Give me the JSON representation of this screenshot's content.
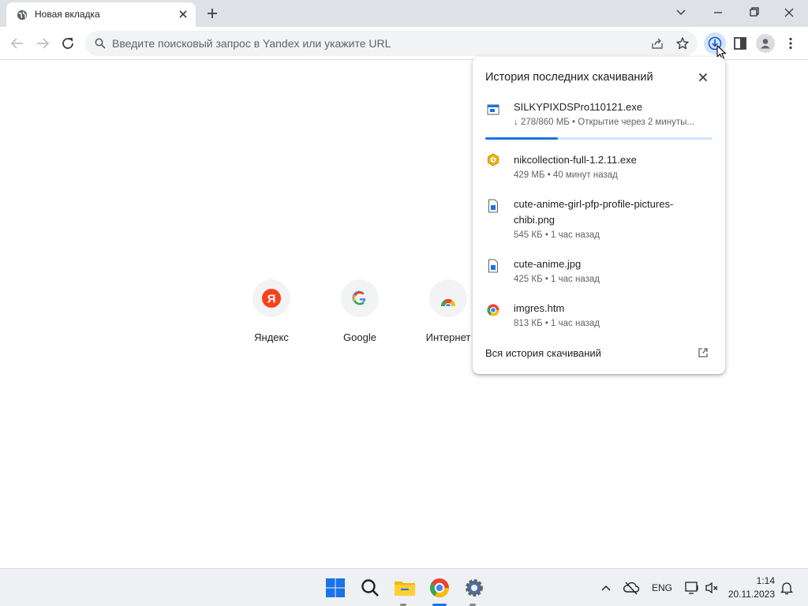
{
  "browser": {
    "tab_title": "Новая вкладка",
    "omnibox_placeholder": "Введите поисковый запрос в Yandex или укажите URL"
  },
  "shortcuts": [
    {
      "label": "Яндекс",
      "icon": "yandex-icon"
    },
    {
      "label": "Google",
      "icon": "google-icon"
    },
    {
      "label": "Интернет",
      "icon": "chrome-webstore-icon"
    }
  ],
  "downloads": {
    "title": "История последних скачиваний",
    "items": [
      {
        "name": "SILKYPIXDSPro110121.exe",
        "status": "↓ 278/860 МБ • Открытие через 2 минуты...",
        "icon": "exe-installer-icon",
        "progress": 0.32
      },
      {
        "name": "nikcollection-full-1.2.11.exe",
        "status": "429 МБ • 40 минут назад",
        "icon": "nik-collection-icon"
      },
      {
        "name": "cute-anime-girl-pfp-profile-pictures-chibi.png",
        "status": "545 КБ • 1 час назад",
        "icon": "image-file-icon"
      },
      {
        "name": "cute-anime.jpg",
        "status": "425 КБ • 1 час назад",
        "icon": "image-file-icon"
      },
      {
        "name": "imgres.htm",
        "status": "813 КБ • 1 час назад",
        "icon": "chrome-html-file-icon"
      }
    ],
    "all_history": "Вся история скачиваний"
  },
  "taskbar": {
    "lang": "ENG",
    "time": "1:14",
    "date": "20.11.2023"
  },
  "colors": {
    "accent": "#1a73e8",
    "titlebar": "#dee1e6",
    "omnibox": "#f1f3f4"
  }
}
